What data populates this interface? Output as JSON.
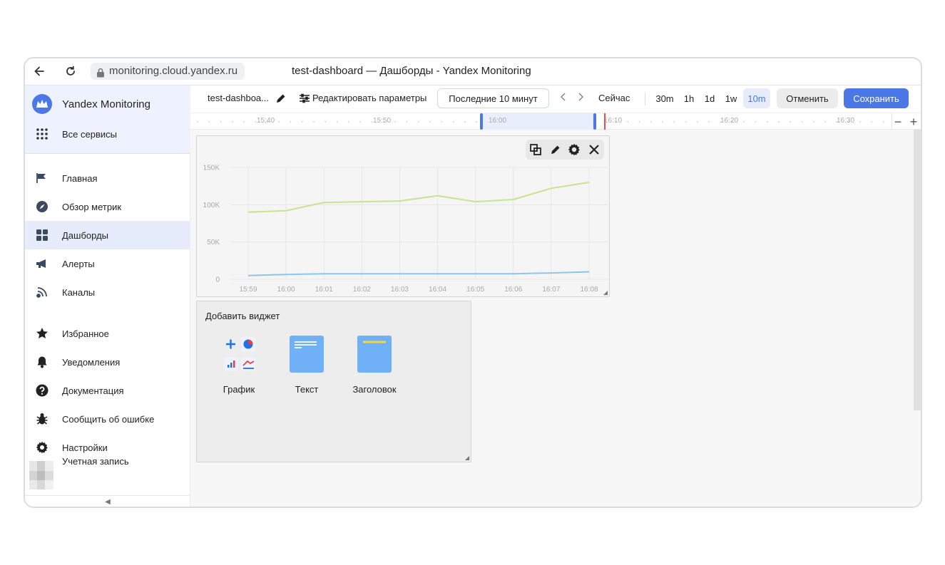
{
  "browser": {
    "url": "monitoring.cloud.yandex.ru",
    "tab_title": "test-dashboard — Дашборды - Yandex Monitoring"
  },
  "sidebar": {
    "brand": "Yandex Monitoring",
    "all_services": "Все сервисы",
    "nav": [
      {
        "label": "Главная",
        "icon": "flag-icon"
      },
      {
        "label": "Обзор метрик",
        "icon": "compass-icon"
      },
      {
        "label": "Дашборды",
        "icon": "dashboard-icon",
        "active": true
      },
      {
        "label": "Алерты",
        "icon": "megaphone-icon"
      },
      {
        "label": "Каналы",
        "icon": "signal-icon"
      }
    ],
    "secondary": [
      {
        "label": "Избранное",
        "icon": "star-icon"
      },
      {
        "label": "Уведомления",
        "icon": "bell-icon"
      },
      {
        "label": "Документация",
        "icon": "help-icon"
      },
      {
        "label": "Сообщить об ошибке",
        "icon": "bug-icon"
      },
      {
        "label": "Настройки",
        "icon": "gear-icon"
      },
      {
        "label": "Учетная запись",
        "icon": "avatar-icon"
      }
    ]
  },
  "toolbar": {
    "dashboard_name": "test-dashboa...",
    "edit_params": "Редактировать параметры",
    "time_range": "Последние 10 минут",
    "now": "Сейчас",
    "presets": [
      "30m",
      "1h",
      "1d",
      "1w",
      "10m"
    ],
    "active_preset": "10m",
    "cancel": "Отменить",
    "save": "Сохранить"
  },
  "timeline": {
    "ticks": [
      "15:40",
      "15:50",
      "16:00",
      "16:10",
      "16:20",
      "16:30"
    ],
    "zoom_out": "−",
    "zoom_in": "+"
  },
  "chart_data": {
    "type": "line",
    "x": [
      "15:59",
      "16:00",
      "16:01",
      "16:02",
      "16:03",
      "16:04",
      "16:05",
      "16:06",
      "16:07",
      "16:08"
    ],
    "yticks": [
      "150K",
      "100K",
      "50K",
      "0"
    ],
    "ylim": [
      0,
      150000
    ],
    "grid": true,
    "series": [
      {
        "color": "#c6e48b",
        "values": [
          90000,
          92000,
          103000,
          104000,
          105000,
          112000,
          104000,
          107000,
          122000,
          130000
        ]
      },
      {
        "color": "#8ec5ea",
        "values": [
          5000,
          6500,
          7500,
          7500,
          7500,
          7500,
          7500,
          7500,
          8500,
          10000
        ]
      }
    ]
  },
  "add_widget": {
    "title": "Добавить виджет",
    "options": [
      {
        "label": "График",
        "icon": "chart-widget-icon"
      },
      {
        "label": "Текст",
        "icon": "text-widget-icon"
      },
      {
        "label": "Заголовок",
        "icon": "title-widget-icon"
      }
    ]
  },
  "colors": {
    "accent": "#4b78e6",
    "active_nav_bg": "#e6ecfc",
    "now_marker": "#e35050"
  }
}
